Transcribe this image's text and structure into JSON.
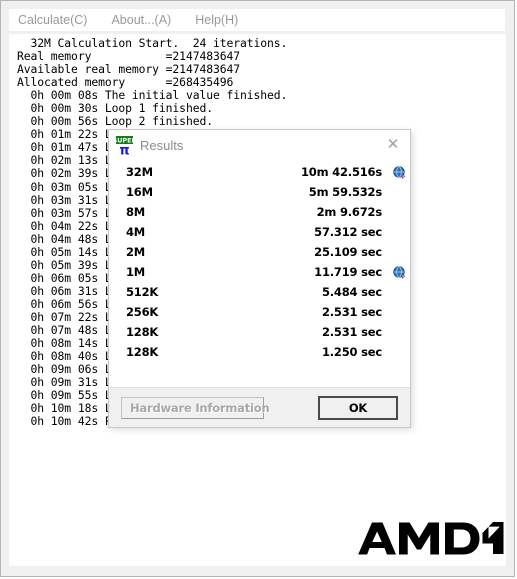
{
  "window": {
    "menu": [
      {
        "label": "Calculate(C)",
        "name": "menu-calculate"
      },
      {
        "label": "About...(A)",
        "name": "menu-about"
      },
      {
        "label": "Help(H)",
        "name": "menu-help"
      }
    ],
    "log_text": "  32M Calculation Start.  24 iterations.\nReal memory           =2147483647\nAvailable real memory =2147483647\nAllocated memory      =268435496\n  0h 00m 08s The initial value finished.\n  0h 00m 30s Loop 1 finished.\n  0h 00m 56s Loop 2 finished.\n  0h 01m 22s Loop 3 finished.\n  0h 01m 47s Loop 4 finished.\n  0h 02m 13s Loop 5 finished.\n  0h 02m 39s Loop 6 finished.\n  0h 03m 05s Loop 7 finished.\n  0h 03m 31s Loop 8 finished.\n  0h 03m 57s Loop 9 finished.\n  0h 04m 22s Loop 10 finished.\n  0h 04m 48s Loop 11 finished.\n  0h 05m 14s Loop 12 finished.\n  0h 05m 39s Loop 13 finished.\n  0h 06m 05s Loop 14 finished.\n  0h 06m 31s Loop 15 finished.\n  0h 06m 56s Loop 16 finished.\n  0h 07m 22s Loop 17 finished.\n  0h 07m 48s Loop 18 finished.\n  0h 08m 14s Loop 19 finished.\n  0h 08m 40s Loop 20 finished.\n  0h 09m 06s Loop 21 finished.\n  0h 09m 31s Loop 22 finished.\n  0h 09m 55s Loop 23 finished.\n  0h 10m 18s Loop 24 finished.\n  0h 10m 42s PI value output.",
    "branding": {
      "logo_text": "AMD",
      "logo_name": "amd-logo"
    }
  },
  "dialog": {
    "title": "Results",
    "icon_name": "superpi-icon",
    "icon_top_text": "SUPER",
    "icon_bottom_text": "π",
    "close_glyph": "✕",
    "rows": [
      {
        "label": "32M",
        "value": "10m 42.516s",
        "globe": true
      },
      {
        "label": "16M",
        "value": "5m 59.532s",
        "globe": false
      },
      {
        "label": "8M",
        "value": "2m 9.672s",
        "globe": false
      },
      {
        "label": "4M",
        "value": "57.312 sec",
        "globe": false
      },
      {
        "label": "2M",
        "value": "25.109 sec",
        "globe": false
      },
      {
        "label": "1M",
        "value": "11.719 sec",
        "globe": true
      },
      {
        "label": "512K",
        "value": "5.484 sec",
        "globe": false
      },
      {
        "label": "256K",
        "value": "2.531 sec",
        "globe": false
      },
      {
        "label": "128K",
        "value": "2.531 sec",
        "globe": false
      },
      {
        "label": "128K",
        "value": "1.250 sec",
        "globe": false
      }
    ],
    "footer": {
      "hardware_label": "Hardware Information",
      "ok_label": "OK"
    }
  },
  "colors": {
    "window_bg": "#f0f0f0",
    "text_area_bg": "#ffffff",
    "menu_text": "#999999",
    "title_text": "#8c8c8c",
    "icon_green": "#108010",
    "icon_blue": "#1818d8",
    "globe_blue": "#2e6fbe"
  }
}
